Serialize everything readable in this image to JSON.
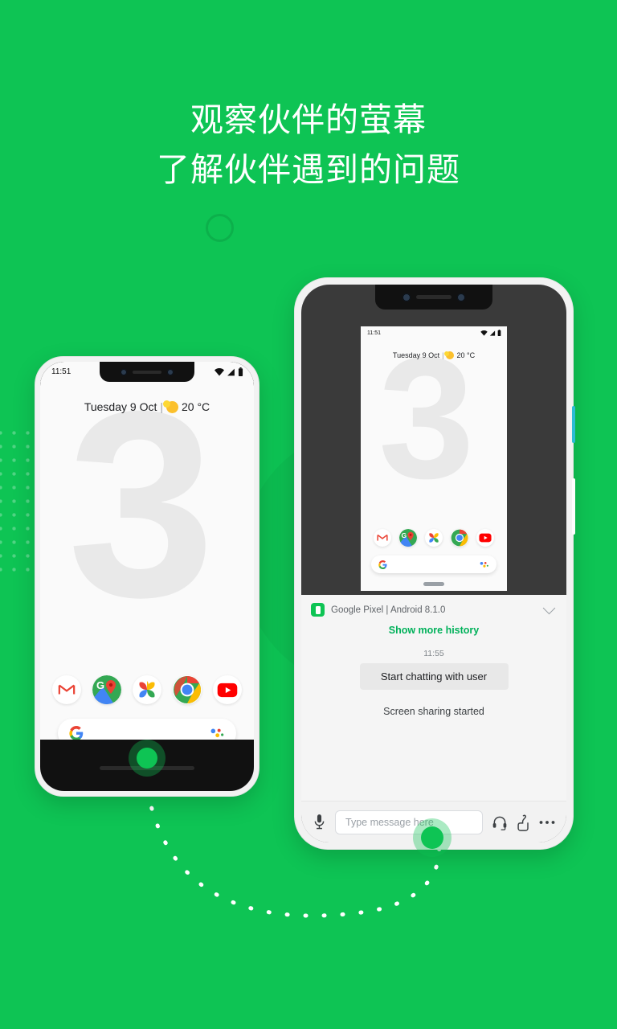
{
  "background_color": "#0ec454",
  "headline": {
    "line1": "观察伙伴的萤幕",
    "line2": "了解伙伴遇到的问题"
  },
  "left_phone": {
    "status": {
      "time": "11:51",
      "wifi": "wifi-icon",
      "signal": "signal-icon",
      "battery": "battery-icon"
    },
    "date_widget": {
      "date": "Tuesday 9 Oct",
      "separator": "|",
      "weather_icon": "sun-icon",
      "temperature": "20 °C"
    },
    "wallpaper_text": "3",
    "dock_apps": [
      {
        "name": "gmail",
        "label": "Gmail"
      },
      {
        "name": "maps",
        "label": "Maps"
      },
      {
        "name": "photos",
        "label": "Photos"
      },
      {
        "name": "chrome",
        "label": "Chrome"
      },
      {
        "name": "youtube",
        "label": "YouTube"
      }
    ],
    "search": {
      "logo": "google-g-icon",
      "assistant": "assistant-icon"
    },
    "touch_indicator": "touch-point"
  },
  "right_phone": {
    "mirror": {
      "status": {
        "time": "11:51",
        "wifi": "wifi-icon",
        "signal": "signal-icon",
        "battery": "battery-icon"
      },
      "date_widget": {
        "date": "Tuesday 9 Oct",
        "separator": "|",
        "weather_icon": "sun-icon",
        "temperature": "20 °C"
      },
      "wallpaper_text": "3",
      "dock_apps": [
        {
          "name": "gmail",
          "label": "Gmail"
        },
        {
          "name": "maps",
          "label": "Maps"
        },
        {
          "name": "photos",
          "label": "Photos"
        },
        {
          "name": "chrome",
          "label": "Chrome"
        },
        {
          "name": "youtube",
          "label": "YouTube"
        }
      ],
      "search": {
        "logo": "google-g-icon",
        "assistant": "assistant-icon"
      }
    },
    "chat": {
      "device_icon": "phone-device-icon",
      "device_title": "Google Pixel | Android 8.1.0",
      "collapse_icon": "chevron-down-icon",
      "show_more": "Show more history",
      "timestamp": "11:55",
      "message_bubble": "Start chatting with user",
      "system_message": "Screen sharing started"
    },
    "input_bar": {
      "mic_icon": "microphone-icon",
      "input_placeholder": "Type message here",
      "headset_icon": "headset-icon",
      "gesture_icon": "pointer-hand-icon",
      "more_icon": "more-options-icon"
    },
    "touch_indicator": "touch-point"
  },
  "decorations": {
    "dot_grid": "dot-grid-pattern",
    "ring": "ring-circle",
    "connector": "dotted-curve-path"
  }
}
